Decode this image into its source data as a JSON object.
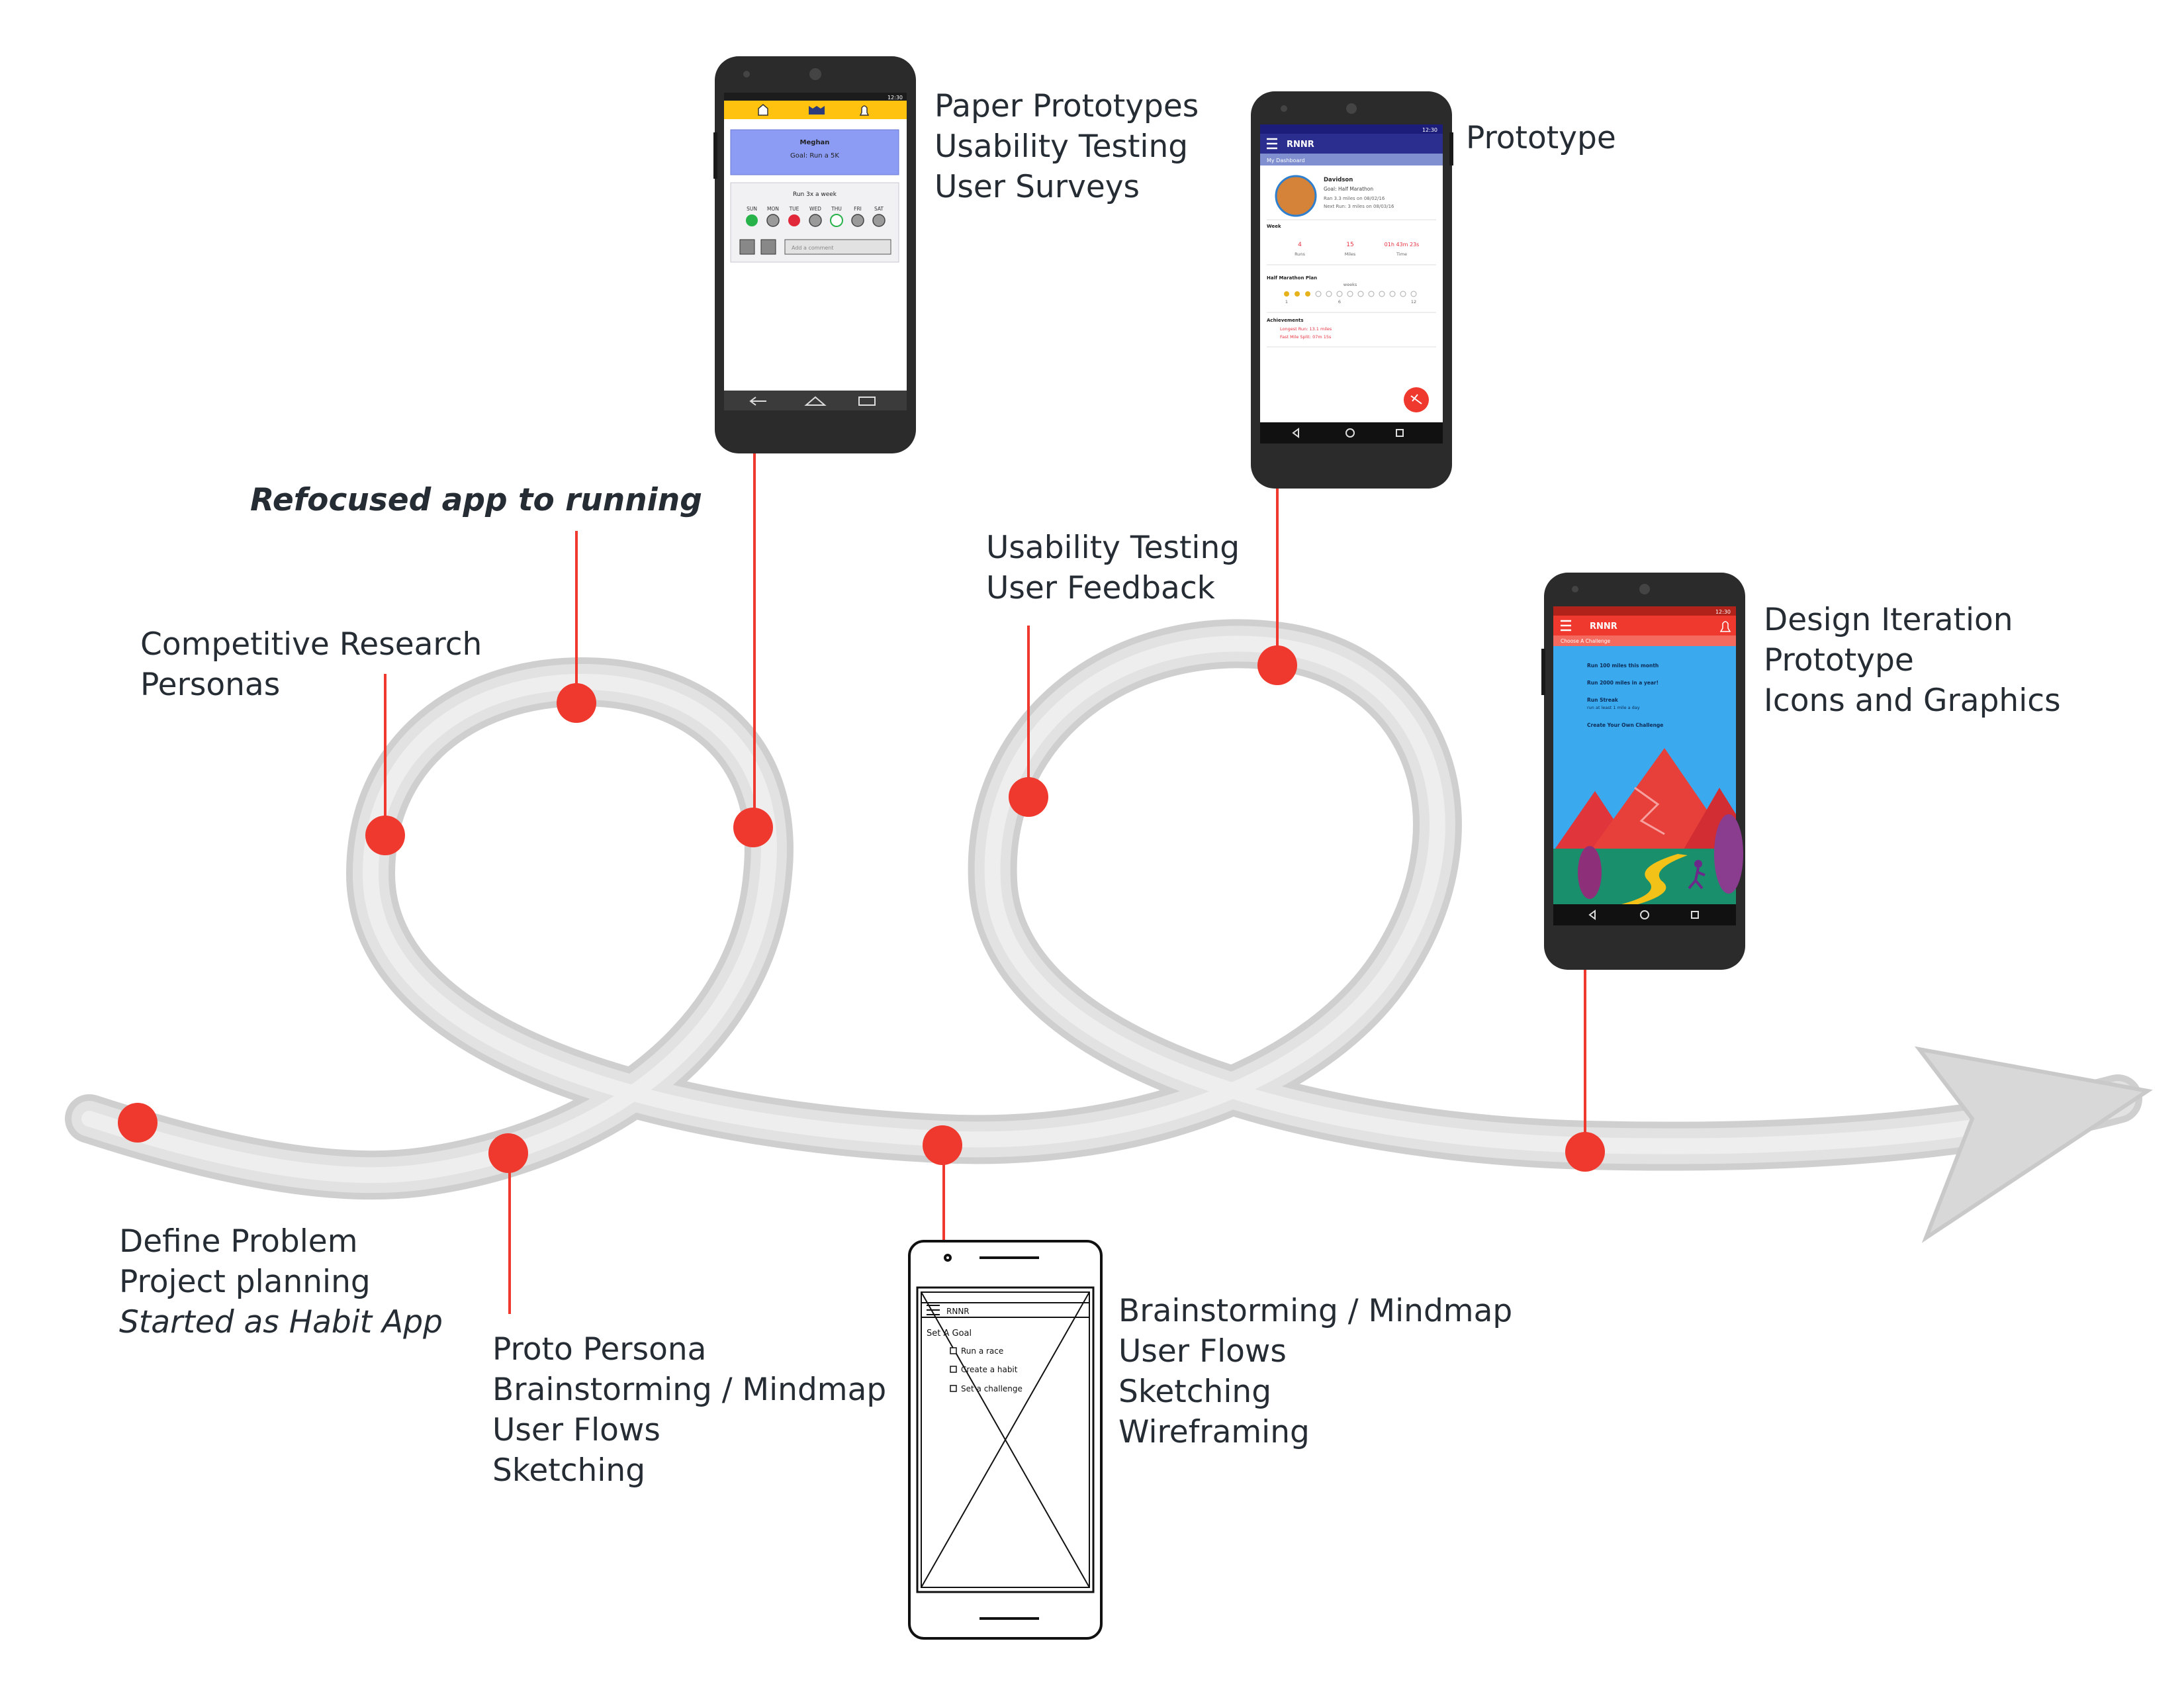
{
  "milestones": {
    "define": [
      "Define Problem",
      "Project planning",
      "Started as Habit App"
    ],
    "competitive": [
      "Competitive Research",
      "Personas"
    ],
    "refocused": "Refocused app to running",
    "paper": [
      "Paper Prototypes",
      "Usability Testing",
      "User Surveys"
    ],
    "proto_persona": [
      "Proto Persona",
      "Brainstorming / Mindmap",
      "User Flows",
      "Sketching"
    ],
    "wireframe": [
      "Brainstorming / Mindmap",
      "User Flows",
      "Sketching",
      "Wireframing"
    ],
    "usability": [
      "Usability Testing",
      "User Feedback"
    ],
    "prototype": "Prototype",
    "design": [
      "Design Iteration",
      "Prototype",
      "Icons and Graphics"
    ]
  },
  "phone_paper": {
    "status_time": "12:30",
    "user_name": "Meghan",
    "goal": "Goal: Run a 5K",
    "habit": "Run 3x a week",
    "days": [
      "SUN",
      "MON",
      "TUE",
      "WED",
      "THU",
      "FRI",
      "SAT"
    ],
    "comment_placeholder": "Add a comment"
  },
  "phone_proto": {
    "status_time": "12:30",
    "app_name": "RNNR",
    "subtitle": "My Dashboard",
    "user": "Davidson",
    "goal": "Goal: Half Marathon",
    "line1": "Ran 3.3 miles on 08/02/16",
    "line2": "Next Run: 3 miles on 08/03/16",
    "week_label": "Week",
    "stats": [
      {
        "value": "4",
        "label": "Runs"
      },
      {
        "value": "15",
        "label": "Miles"
      },
      {
        "value": "01h 43m 23s",
        "label": "Time"
      }
    ],
    "plan_label": "Half Marathon Plan",
    "plan_sub": "weeks",
    "plan_ticks": [
      "1",
      "6",
      "12"
    ],
    "ach_label": "Achievements",
    "ach1": "Longest Run: 13.1 miles",
    "ach2": "Fast Mile Split: 07m 15s"
  },
  "phone_design": {
    "status_time": "12:30",
    "app_name": "RNNR",
    "subtitle": "Choose A Challenge",
    "items": [
      {
        "title": "Run 100 miles this month",
        "sub": ""
      },
      {
        "title": "Run 2000 miles in a year!",
        "sub": ""
      },
      {
        "title": "Run Streak",
        "sub": "run at least 1 mile a day"
      },
      {
        "title": "Create Your Own Challenge",
        "sub": ""
      }
    ]
  },
  "phone_wire": {
    "app_name": "RNNR",
    "heading": "Set A Goal",
    "options": [
      "Run a race",
      "Create a habit",
      "Set a challenge"
    ]
  },
  "colors": {
    "accent_red": "#f0392e",
    "path_gray": "#dcdcdc",
    "text": "#262c33",
    "paper_yellow": "#ffc20e",
    "proto_blue": "#2b2e8f",
    "design_red": "#f0392e",
    "design_sky": "#3aa9ee"
  },
  "icons": [
    "arrow-head-icon",
    "home-icon",
    "menu-icon",
    "bell-icon",
    "run-fab-icon"
  ]
}
